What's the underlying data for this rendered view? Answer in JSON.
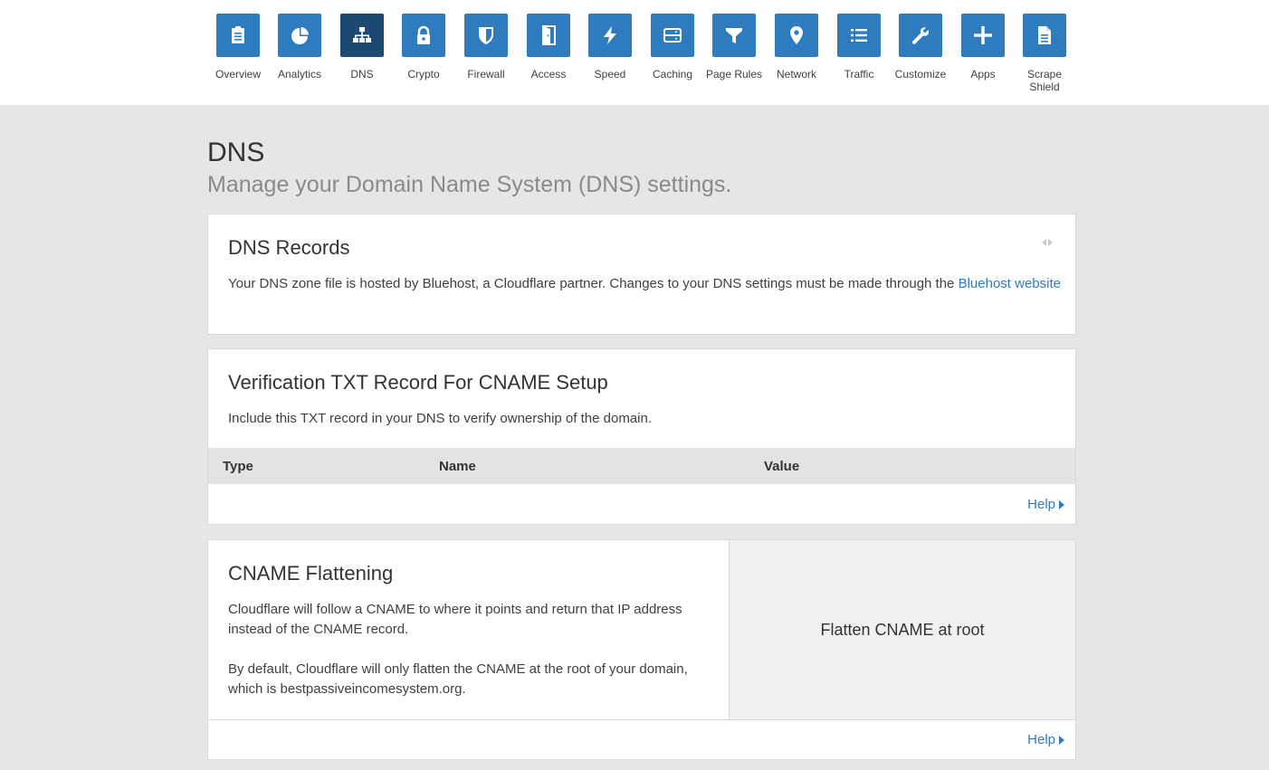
{
  "nav": {
    "items": [
      {
        "label": "Overview",
        "icon": "clipboard-icon"
      },
      {
        "label": "Analytics",
        "icon": "pie-chart-icon"
      },
      {
        "label": "DNS",
        "icon": "sitemap-icon",
        "active": true
      },
      {
        "label": "Crypto",
        "icon": "lock-icon"
      },
      {
        "label": "Firewall",
        "icon": "shield-icon"
      },
      {
        "label": "Access",
        "icon": "door-icon"
      },
      {
        "label": "Speed",
        "icon": "lightning-icon"
      },
      {
        "label": "Caching",
        "icon": "server-icon"
      },
      {
        "label": "Page Rules",
        "icon": "filter-icon"
      },
      {
        "label": "Network",
        "icon": "map-pin-icon"
      },
      {
        "label": "Traffic",
        "icon": "list-icon"
      },
      {
        "label": "Customize",
        "icon": "wrench-icon"
      },
      {
        "label": "Apps",
        "icon": "plus-icon"
      },
      {
        "label": "Scrape\nShield",
        "icon": "document-icon"
      }
    ]
  },
  "page": {
    "title": "DNS",
    "subtitle": "Manage your Domain Name System (DNS) settings."
  },
  "dns_records": {
    "title": "DNS Records",
    "text": "Your DNS zone file is hosted by Bluehost, a Cloudflare partner. Changes to your DNS settings must be made through the ",
    "link": "Bluehost website"
  },
  "txt_record": {
    "title": "Verification TXT Record For CNAME Setup",
    "text": "Include this TXT record in your DNS to verify ownership of the domain.",
    "columns": [
      "Type",
      "Name",
      "Value"
    ],
    "help": "Help"
  },
  "cname": {
    "title": "CNAME Flattening",
    "p1": "Cloudflare will follow a CNAME to where it points and return that IP address instead of the CNAME record.",
    "p2": "By default, Cloudflare will only flatten the CNAME at the root of your domain, which is bestpassiveincomesystem.org.",
    "setting": "Flatten CNAME at root",
    "help": "Help"
  },
  "colors": {
    "tile": "#2f7bbf",
    "tile_active": "#1d4a73",
    "link": "#2f7bbf",
    "background": "#e6e6e6"
  }
}
